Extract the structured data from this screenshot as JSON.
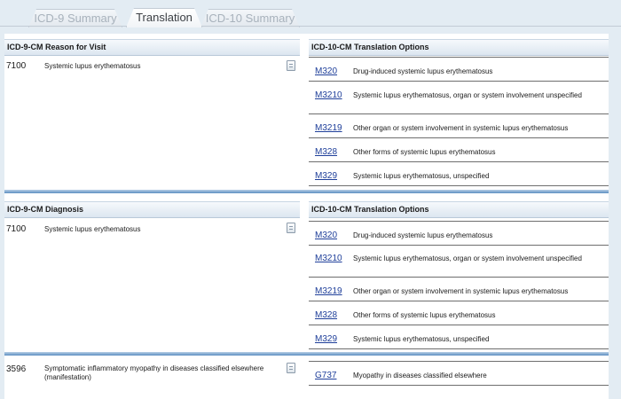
{
  "tabs": [
    {
      "label": "ICD-9 Summary"
    },
    {
      "label": "Translation"
    },
    {
      "label": "ICD-10 Summary"
    }
  ],
  "sections": [
    {
      "left_header": "ICD-9-CM Reason for Visit",
      "right_header": "ICD-10-CM Translation Options",
      "code": "7100",
      "description": "Systemic lupus erythematosus",
      "options": [
        {
          "code": "M320",
          "description": "Drug-induced systemic lupus erythematosus"
        },
        {
          "code": "M3210",
          "description": "Systemic lupus erythematosus, organ or system involvement unspecified"
        },
        {
          "code": "M3219",
          "description": "Other organ or system involvement in systemic lupus erythematosus"
        },
        {
          "code": "M328",
          "description": "Other forms of systemic lupus erythematosus"
        },
        {
          "code": "M329",
          "description": "Systemic lupus erythematosus, unspecified"
        }
      ]
    },
    {
      "left_header": "ICD-9-CM Diagnosis",
      "right_header": "ICD-10-CM Translation Options",
      "code": "7100",
      "description": "Systemic lupus erythematosus",
      "options": [
        {
          "code": "M320",
          "description": "Drug-induced systemic lupus erythematosus"
        },
        {
          "code": "M3210",
          "description": "Systemic lupus erythematosus, organ or system involvement unspecified"
        },
        {
          "code": "M3219",
          "description": "Other organ or system involvement in systemic lupus erythematosus"
        },
        {
          "code": "M328",
          "description": "Other forms of systemic lupus erythematosus"
        },
        {
          "code": "M329",
          "description": "Systemic lupus erythematosus, unspecified"
        }
      ]
    },
    {
      "code": "3596",
      "description": "Symptomatic inflammatory myopathy in diseases classified elsewhere (manifestation)",
      "options": [
        {
          "code": "G737",
          "description": "Myopathy in diseases classified elsewhere"
        }
      ]
    }
  ],
  "icons": {
    "note": "document-icon"
  }
}
